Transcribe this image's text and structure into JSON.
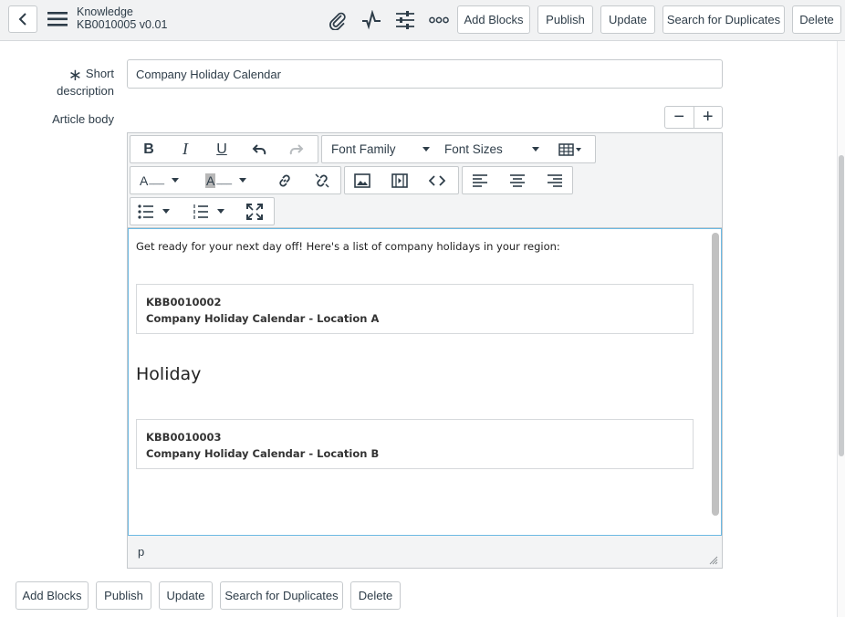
{
  "header": {
    "title": "Knowledge",
    "subtitle": "KB0010005 v0.01",
    "buttons": {
      "add_blocks": "Add Blocks",
      "publish": "Publish",
      "update": "Update",
      "search_duplicates": "Search for Duplicates",
      "delete": "Delete"
    },
    "icons": [
      "back-icon",
      "menu-icon",
      "attachment-icon",
      "activity-icon",
      "settings-sliders-icon",
      "more-icon"
    ]
  },
  "form": {
    "short_description": {
      "label_line1": "Short",
      "label_line2": "description",
      "required_mark": "∗",
      "value": "Company Holiday Calendar"
    },
    "article_body_label": "Article body",
    "zoom_out": "−",
    "zoom_in": "+"
  },
  "editor": {
    "toolbar": {
      "bold": "B",
      "italic": "I",
      "underline": "U",
      "font_family": "Font Family",
      "font_sizes": "Font Sizes",
      "text_color": "A",
      "bg_color": "A"
    },
    "content": {
      "intro": "Get ready for your next day off! Here's a list of company holidays in your region:",
      "cards": [
        {
          "number": "KBB0010002",
          "title": "Company Holiday Calendar - Location A"
        },
        {
          "number": "KBB0010003",
          "title": "Company Holiday Calendar - Location B"
        }
      ],
      "heading": "Holiday"
    },
    "status_path": "p"
  },
  "footer": {
    "add_blocks": "Add Blocks",
    "publish": "Publish",
    "update": "Update",
    "search_duplicates": "Search for Duplicates",
    "delete": "Delete"
  }
}
